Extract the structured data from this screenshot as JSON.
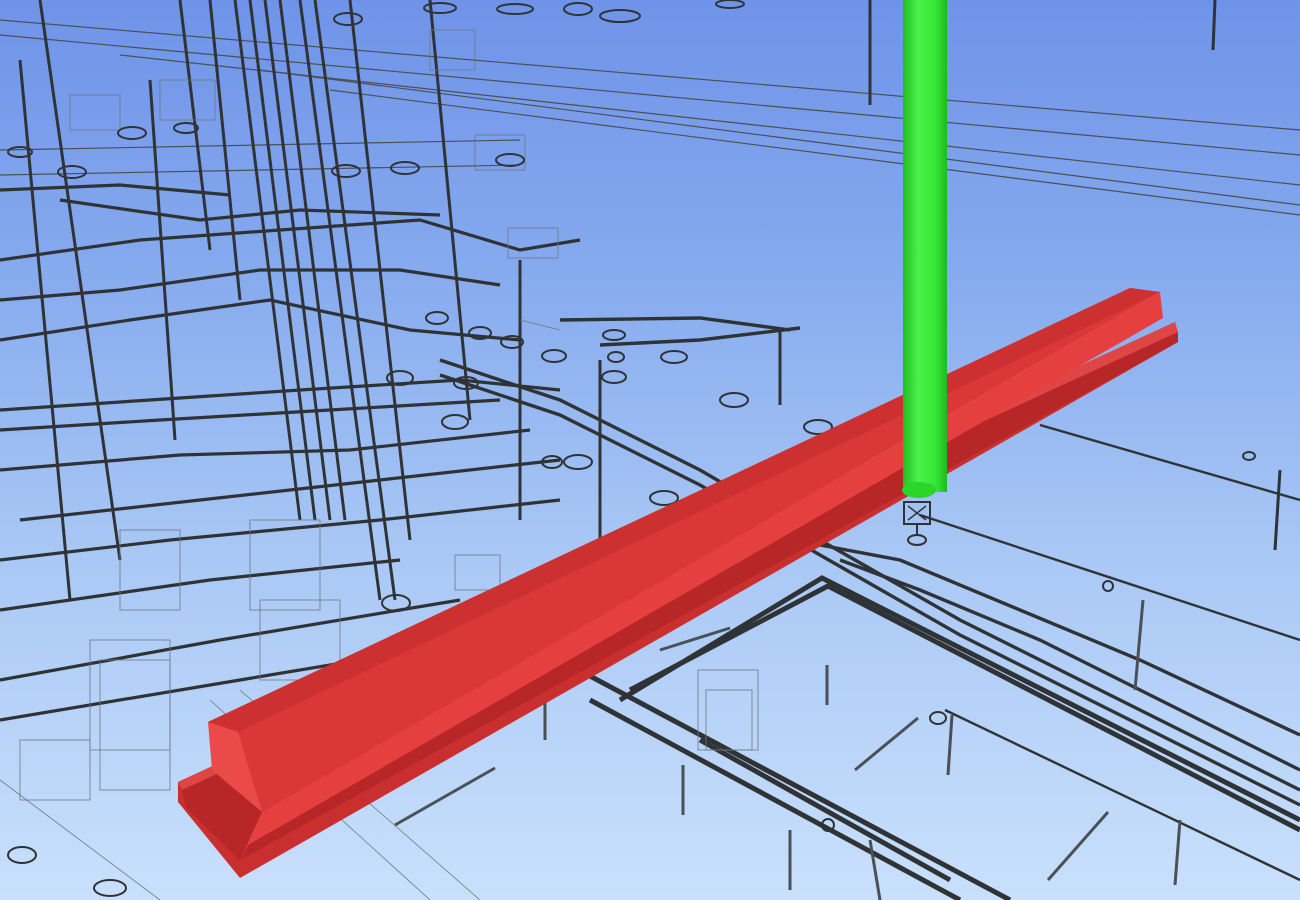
{
  "viewer": {
    "background_top": "#6f93e8",
    "background_bottom": "#c9e0fc",
    "wireframe_color": "#2f3336"
  },
  "clash": {
    "beam_color": "#dd3a3a",
    "pipe_color": "#35e635"
  },
  "icons": {
    "beam": "structural-beam-icon",
    "pipe": "vertical-pipe-icon",
    "sprinkler": "sprinkler-head-icon"
  }
}
